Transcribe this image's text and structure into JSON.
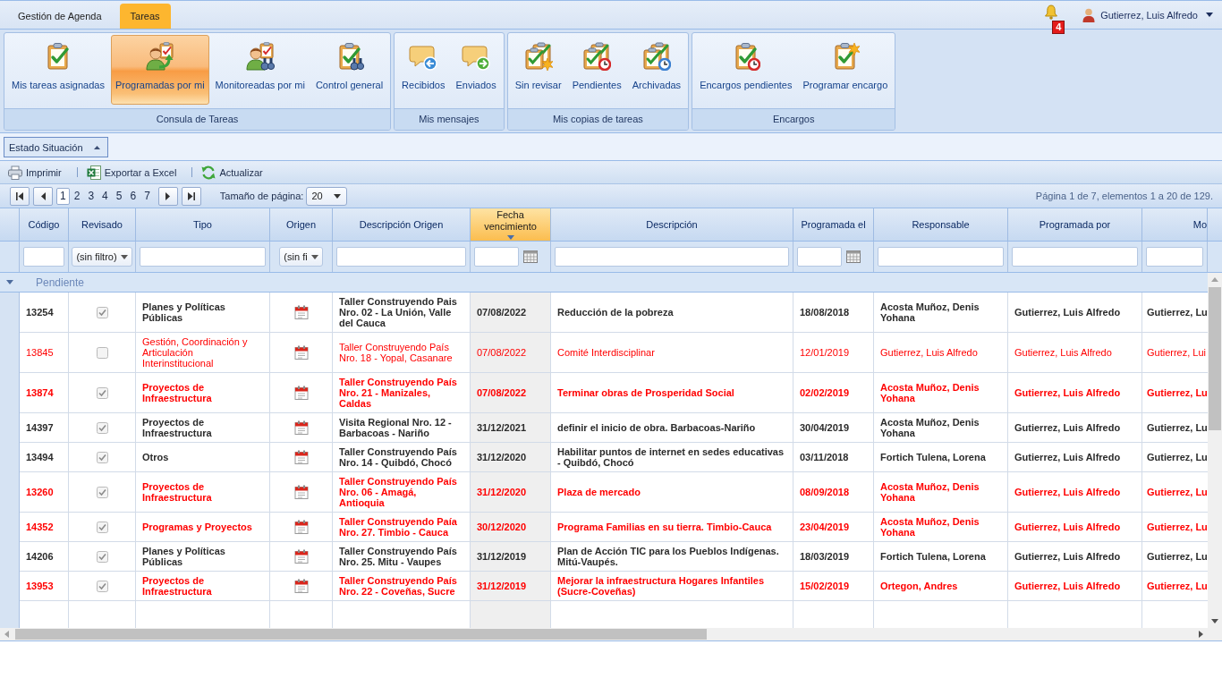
{
  "top_bar": {
    "tabs": [
      {
        "label": "Gestión de Agenda",
        "selected": false
      },
      {
        "label": "Tareas",
        "selected": true
      }
    ],
    "notification_count": "4",
    "user_name": "Gutierrez, Luis Alfredo"
  },
  "ribbon": {
    "groups": [
      {
        "title": "Consula de Tareas",
        "buttons": [
          {
            "label": "Mis tareas asignadas",
            "selected": false
          },
          {
            "label": "Programadas por mi",
            "selected": true
          },
          {
            "label": "Monitoreadas por mi",
            "selected": false
          },
          {
            "label": "Control general",
            "selected": false
          }
        ]
      },
      {
        "title": "Mis mensajes",
        "buttons": [
          {
            "label": "Recibidos",
            "selected": false
          },
          {
            "label": "Enviados",
            "selected": false
          }
        ]
      },
      {
        "title": "Mis copias de tareas",
        "buttons": [
          {
            "label": "Sin revisar",
            "selected": false
          },
          {
            "label": "Pendientes",
            "selected": false
          },
          {
            "label": "Archivadas",
            "selected": false
          }
        ]
      },
      {
        "title": "Encargos",
        "buttons": [
          {
            "label": "Encargos pendientes",
            "selected": false
          },
          {
            "label": "Programar encargo",
            "selected": false
          }
        ]
      }
    ]
  },
  "filter_panel": {
    "label": "Estado Situación"
  },
  "toolbar": [
    {
      "label": "Imprimir"
    },
    {
      "label": "Exportar a Excel"
    },
    {
      "label": "Actualizar"
    }
  ],
  "pager": {
    "pages": [
      {
        "label": "1",
        "selected": true
      },
      {
        "label": "2",
        "selected": false
      },
      {
        "label": "3",
        "selected": false
      },
      {
        "label": "4",
        "selected": false
      },
      {
        "label": "5",
        "selected": false
      },
      {
        "label": "6",
        "selected": false
      },
      {
        "label": "7",
        "selected": false
      }
    ],
    "page_size_label": "Tamaño de página:",
    "page_size": "20",
    "summary": "Página 1 de 7, elementos 1 a 20 de 129."
  },
  "table": {
    "columns": [
      {
        "label": "Código",
        "sorted": false,
        "filter": {
          "kind": "text"
        }
      },
      {
        "label": "Revisado",
        "sorted": false,
        "filter": {
          "kind": "select",
          "value": "(sin filtro)"
        }
      },
      {
        "label": "Tipo",
        "sorted": false,
        "filter": {
          "kind": "text"
        }
      },
      {
        "label": "Origen",
        "sorted": false,
        "filter": {
          "kind": "select",
          "value": "(sin fi"
        }
      },
      {
        "label": "Descripción Origen",
        "sorted": false,
        "filter": {
          "kind": "text"
        }
      },
      {
        "label": "Fecha vencimiento",
        "sorted": true,
        "filter": {
          "kind": "date"
        }
      },
      {
        "label": "Descripción",
        "sorted": false,
        "filter": {
          "kind": "text"
        }
      },
      {
        "label": "Programada el",
        "sorted": false,
        "filter": {
          "kind": "date"
        }
      },
      {
        "label": "Responsable",
        "sorted": false,
        "filter": {
          "kind": "text"
        }
      },
      {
        "label": "Programada por",
        "sorted": false,
        "filter": {
          "kind": "text"
        }
      },
      {
        "label": "Mo",
        "sorted": false,
        "filter": {
          "kind": "text"
        }
      }
    ],
    "group": {
      "label": "Pendiente",
      "expanded": true
    },
    "rows": [
      {
        "codigo": "13254",
        "revisado": true,
        "tipo": "Planes y Políticas Públicas",
        "descripcion_origen": "Taller Construyendo Pais Nro. 02 - La Unión, Valle del Cauca",
        "fecha_vencimiento": "07/08/2022",
        "descripcion": "Reducción de la pobreza",
        "programada_el": "18/08/2018",
        "responsable": "Acosta Muñoz, Denis Yohana",
        "programada_por": "Gutierrez, Luis Alfredo",
        "column_11": "Gutierrez, Lu",
        "highlighted": false,
        "bold": true
      },
      {
        "codigo": "13845",
        "revisado": false,
        "tipo": "Gestión, Coordinación y Articulación Interinstitucional",
        "descripcion_origen": "Taller Construyendo País Nro. 18 - Yopal, Casanare",
        "fecha_vencimiento": "07/08/2022",
        "descripcion": "Comité Interdisciplinar",
        "programada_el": "12/01/2019",
        "responsable": "Gutierrez, Luis Alfredo",
        "programada_por": "Gutierrez, Luis Alfredo",
        "column_11": "Gutierrez, Lui",
        "highlighted": true,
        "bold": false
      },
      {
        "codigo": "13874",
        "revisado": true,
        "tipo": "Proyectos de Infraestructura",
        "descripcion_origen": "Taller Construyendo País Nro. 21 - Manizales, Caldas",
        "fecha_vencimiento": "07/08/2022",
        "descripcion": "Terminar obras de Prosperidad Social",
        "programada_el": "02/02/2019",
        "responsable": "Acosta Muñoz, Denis Yohana",
        "programada_por": "Gutierrez, Luis Alfredo",
        "column_11": "Gutierrez, Lu",
        "highlighted": true,
        "bold": true
      },
      {
        "codigo": "14397",
        "revisado": true,
        "tipo": "Proyectos de Infraestructura",
        "descripcion_origen": "Visita Regional Nro. 12 - Barbacoas - Nariño",
        "fecha_vencimiento": "31/12/2021",
        "descripcion": "definir el inicio de obra. Barbacoas-Nariño",
        "programada_el": "30/04/2019",
        "responsable": "Acosta Muñoz, Denis Yohana",
        "programada_por": "Gutierrez, Luis Alfredo",
        "column_11": "Gutierrez, Lu",
        "highlighted": false,
        "bold": true
      },
      {
        "codigo": "13494",
        "revisado": true,
        "tipo": "Otros",
        "descripcion_origen": "Taller Construyendo País Nro. 14 - Quibdó, Chocó",
        "fecha_vencimiento": "31/12/2020",
        "descripcion": "Habilitar puntos de internet en sedes educativas - Quibdó, Chocó",
        "programada_el": "03/11/2018",
        "responsable": "Fortich Tulena, Lorena",
        "programada_por": "Gutierrez, Luis Alfredo",
        "column_11": "Gutierrez, Lu",
        "highlighted": false,
        "bold": true
      },
      {
        "codigo": "13260",
        "revisado": true,
        "tipo": "Proyectos de Infraestructura",
        "descripcion_origen": "Taller Construyendo País Nro. 06 - Amagá, Antioquia",
        "fecha_vencimiento": "31/12/2020",
        "descripcion": "Plaza de mercado",
        "programada_el": "08/09/2018",
        "responsable": "Acosta Muñoz, Denis Yohana",
        "programada_por": "Gutierrez, Luis Alfredo",
        "column_11": "Gutierrez, Lu",
        "highlighted": true,
        "bold": true
      },
      {
        "codigo": "14352",
        "revisado": true,
        "tipo": "Programas y Proyectos",
        "descripcion_origen": "Taller Construyendo Paía Nro. 27. Timbio - Cauca",
        "fecha_vencimiento": "30/12/2020",
        "descripcion": "Programa Familias en su tierra. Timbio-Cauca",
        "programada_el": "23/04/2019",
        "responsable": "Acosta Muñoz, Denis Yohana",
        "programada_por": "Gutierrez, Luis Alfredo",
        "column_11": "Gutierrez, Lu",
        "highlighted": true,
        "bold": true
      },
      {
        "codigo": "14206",
        "revisado": true,
        "tipo": "Planes y Políticas Públicas",
        "descripcion_origen": "Taller Construyendo País Nro. 25. Mitu - Vaupes",
        "fecha_vencimiento": "31/12/2019",
        "descripcion": "Plan de Acción TIC para los Pueblos Indígenas. Mitú-Vaupés.",
        "programada_el": "18/03/2019",
        "responsable": "Fortich Tulena, Lorena",
        "programada_por": "Gutierrez, Luis Alfredo",
        "column_11": "Gutierrez, Lu",
        "highlighted": false,
        "bold": true
      },
      {
        "codigo": "13953",
        "revisado": true,
        "tipo": "Proyectos de Infraestructura",
        "descripcion_origen": "Taller Construyendo País Nro. 22 - Coveñas, Sucre",
        "fecha_vencimiento": "31/12/2019",
        "descripcion": "Mejorar la infraestructura Hogares Infantiles (Sucre-Coveñas)",
        "programada_el": "15/02/2019",
        "responsable": "Ortegon, Andres",
        "programada_por": "Gutierrez, Luis Alfredo",
        "column_11": "Gutierrez, Lu",
        "highlighted": true,
        "bold": true
      }
    ]
  }
}
